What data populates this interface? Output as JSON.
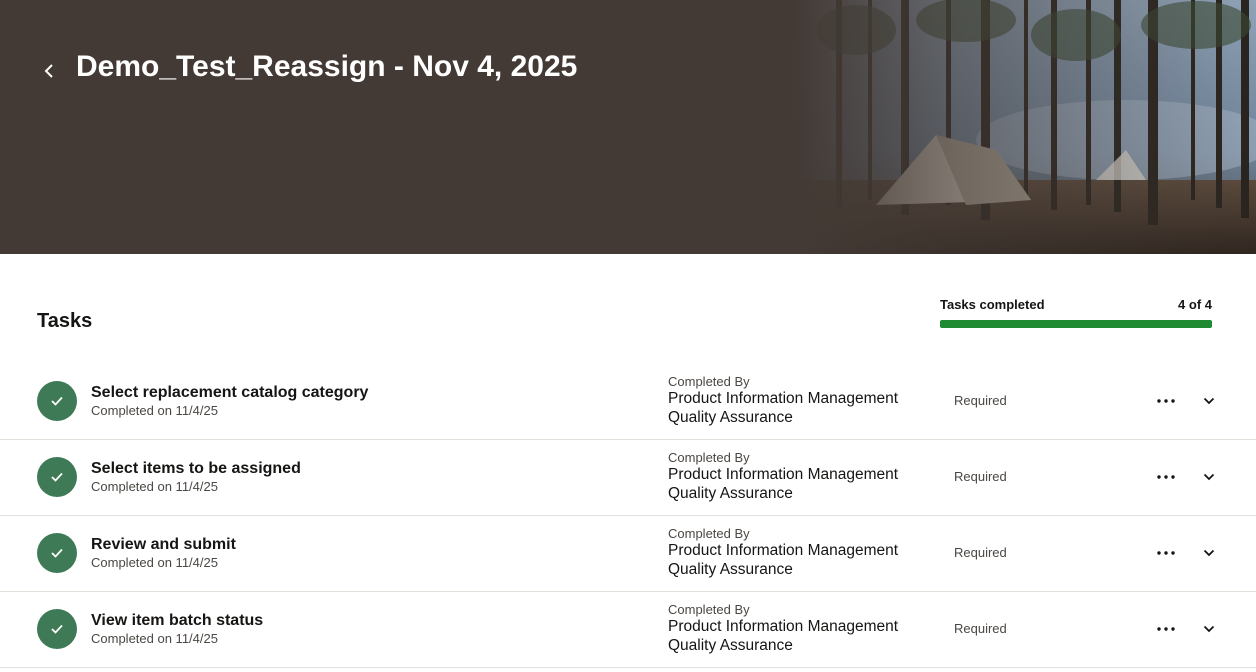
{
  "header": {
    "title": "Demo_Test_Reassign - Nov 4, 2025",
    "back_icon": "chevron-left-icon",
    "background_color": "#433a35"
  },
  "tasks_section": {
    "heading": "Tasks",
    "progress": {
      "label": "Tasks completed",
      "count_text": "4 of 4",
      "completed": 4,
      "total": 4,
      "fill_fraction": 1.0,
      "color": "#1f8a32"
    }
  },
  "tasks": [
    {
      "title": "Select replacement catalog category",
      "completed_text": "Completed on 11/4/25",
      "completed_by_label": "Completed By",
      "completed_by_line1": "Product Information Management",
      "completed_by_line2": "Quality Assurance",
      "requirement": "Required",
      "status_icon": "check-icon",
      "status_color": "#3d7a55"
    },
    {
      "title": "Select items to be assigned",
      "completed_text": "Completed on 11/4/25",
      "completed_by_label": "Completed By",
      "completed_by_line1": "Product Information Management",
      "completed_by_line2": "Quality Assurance",
      "requirement": "Required",
      "status_icon": "check-icon",
      "status_color": "#3d7a55"
    },
    {
      "title": "Review and submit",
      "completed_text": "Completed on 11/4/25",
      "completed_by_label": "Completed By",
      "completed_by_line1": "Product Information Management",
      "completed_by_line2": "Quality Assurance",
      "requirement": "Required",
      "status_icon": "check-icon",
      "status_color": "#3d7a55"
    },
    {
      "title": "View item batch status",
      "completed_text": "Completed on 11/4/25",
      "completed_by_label": "Completed By",
      "completed_by_line1": "Product Information Management",
      "completed_by_line2": "Quality Assurance",
      "requirement": "Required",
      "status_icon": "check-icon",
      "status_color": "#3d7a55"
    }
  ]
}
